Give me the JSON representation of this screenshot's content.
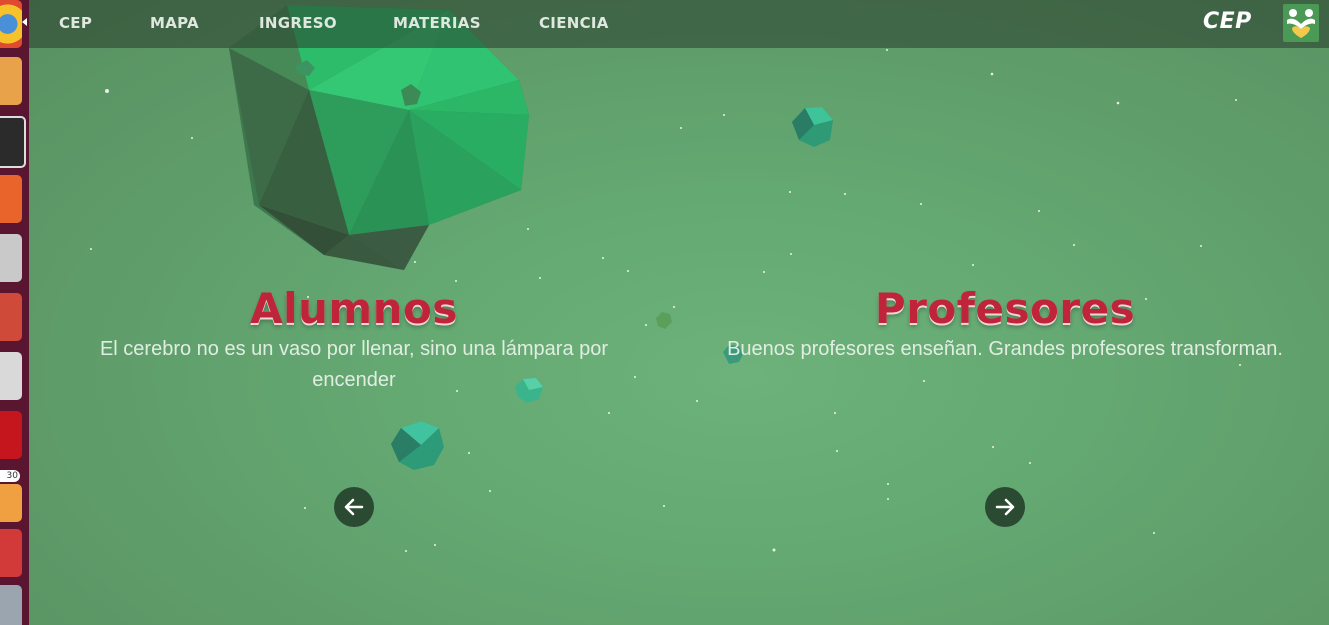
{
  "nav": {
    "items": [
      {
        "label": "CEP"
      },
      {
        "label": "MAPA"
      },
      {
        "label": "INGRESO"
      },
      {
        "label": "MATERIAS"
      },
      {
        "label": "CIENCIA"
      }
    ],
    "brand": "CEP",
    "logo_icon": "hands-heart-icon"
  },
  "slides": [
    {
      "title": "Alumnos",
      "text": "El cerebro no es un vaso por llenar, sino una lámpara por encender",
      "button_icon": "arrow-left-icon"
    },
    {
      "title": "Profesores",
      "text": "Buenos profesores enseñan. Grandes profesores transforman.",
      "button_icon": "arrow-right-icon"
    }
  ],
  "launcher": {
    "badge": "30",
    "apps": [
      "browser-icon",
      "git-icon",
      "terminal-icon",
      "files-icon",
      "presentation-icon",
      "settings-icon",
      "screenshot-icon",
      "filezilla-icon",
      "update-icon",
      "popcorn-icon",
      "disk-icon"
    ]
  },
  "colors": {
    "background": "#5d9a68",
    "title": "#c0243a",
    "navbar": "#3f5c46",
    "asteroid": "#2fa46a",
    "button": "#2b4a32"
  }
}
